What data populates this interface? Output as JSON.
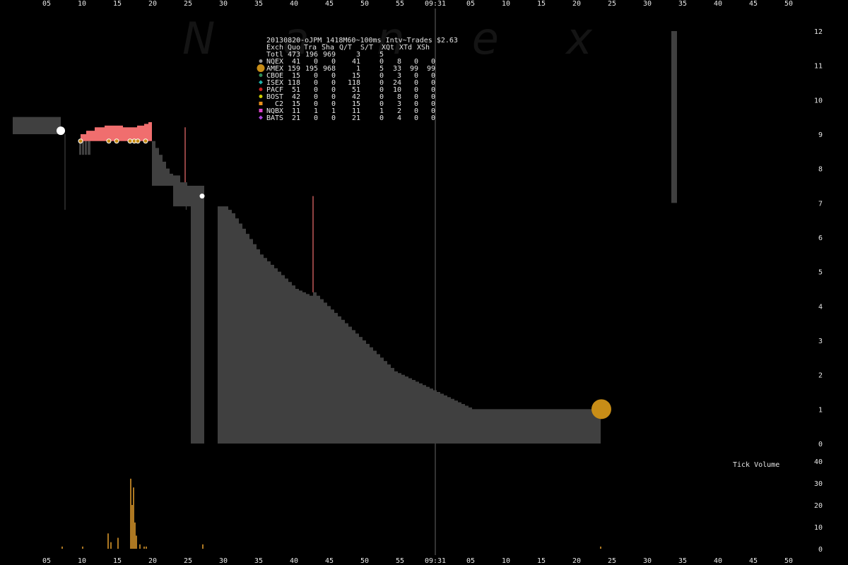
{
  "chart_data": {
    "type": "bar",
    "title": "20130820-oJPM_1418M60~100ms Intv~Trades $2.63",
    "watermark": "Nanex",
    "background": "#000000",
    "colors": {
      "price_band": "#404040",
      "bid_band": "#f06e6e",
      "grid": "#555555",
      "center_line": "#666666",
      "trade_amex": "#c88d17",
      "volume": "#d8962a",
      "nqex": "#999999",
      "cboe": "#2e8b57",
      "isex": "#20b2aa",
      "pacf": "#cc2222",
      "bost": "#cccc00",
      "c2": "#e8901b",
      "nqbx": "#dd44cc",
      "bats": "#aa44dd"
    },
    "x_ticks": [
      "05",
      "10",
      "15",
      "20",
      "25",
      "30",
      "35",
      "40",
      "45",
      "50",
      "55",
      "09:31",
      "05",
      "10",
      "15",
      "20",
      "25",
      "30",
      "35",
      "40",
      "45",
      "50"
    ],
    "x_axis": {
      "first_seconds": 5,
      "step_seconds": 5,
      "center_label": "09:31"
    },
    "price_axis": {
      "min": 0,
      "max": 12,
      "ticks": [
        "0",
        "1",
        "2",
        "3",
        "4",
        "5",
        "6",
        "7",
        "8",
        "9",
        "10",
        "11",
        "12"
      ]
    },
    "volume_axis": {
      "label": "Tick Volume",
      "min": 0,
      "max": 40,
      "ticks": [
        "0",
        "10",
        "20",
        "30",
        "40"
      ]
    },
    "legend": {
      "header": [
        "Exch",
        "Quo",
        "Tra",
        "Sha",
        "Q/T",
        "S/T",
        "XQt",
        "XTd",
        "XSh"
      ],
      "total": {
        "name": "Totl",
        "values": [
          "473",
          "196",
          "969",
          "3",
          "5",
          "",
          "",
          ""
        ]
      },
      "rows": [
        {
          "name": "NQEX",
          "marker": "circle",
          "color_key": "nqex",
          "values": [
            "41",
            "0",
            "0",
            "41",
            "0",
            "8",
            "0",
            "0"
          ]
        },
        {
          "name": "AMEX",
          "marker": "circle-large",
          "color_key": "trade_amex",
          "values": [
            "159",
            "195",
            "968",
            "1",
            "5",
            "33",
            "99",
            "99"
          ]
        },
        {
          "name": "CBOE",
          "marker": "circle",
          "color_key": "cboe",
          "values": [
            "15",
            "0",
            "0",
            "15",
            "0",
            "3",
            "0",
            "0"
          ]
        },
        {
          "name": "ISEX",
          "marker": "diamond",
          "color_key": "isex",
          "values": [
            "118",
            "0",
            "0",
            "118",
            "0",
            "24",
            "0",
            "0"
          ]
        },
        {
          "name": "PACF",
          "marker": "circle",
          "color_key": "pacf",
          "values": [
            "51",
            "0",
            "0",
            "51",
            "0",
            "10",
            "0",
            "0"
          ]
        },
        {
          "name": "BOST",
          "marker": "circle",
          "color_key": "bost",
          "values": [
            "42",
            "0",
            "0",
            "42",
            "0",
            "8",
            "0",
            "0"
          ]
        },
        {
          "name": "C2",
          "marker": "square",
          "color_key": "c2",
          "values": [
            "15",
            "0",
            "0",
            "15",
            "0",
            "3",
            "0",
            "0"
          ]
        },
        {
          "name": "NQBX",
          "marker": "square",
          "color_key": "nqbx",
          "values": [
            "11",
            "1",
            "1",
            "11",
            "1",
            "2",
            "0",
            "0"
          ]
        },
        {
          "name": "BATS",
          "marker": "diamond",
          "color_key": "bats",
          "values": [
            "21",
            "0",
            "0",
            "21",
            "0",
            "4",
            "0",
            "0"
          ]
        }
      ]
    },
    "price_bands": [
      {
        "t0": 0.2,
        "t1": 7.0,
        "lo": 9.0,
        "hi": 9.5
      },
      {
        "t0": 9.6,
        "t1": 9.9,
        "lo": 8.4,
        "hi": 8.8
      },
      {
        "t0": 10.0,
        "t1": 10.3,
        "lo": 8.4,
        "hi": 8.8
      },
      {
        "t0": 10.4,
        "t1": 10.7,
        "lo": 8.4,
        "hi": 8.8
      },
      {
        "t0": 10.8,
        "t1": 11.2,
        "lo": 8.4,
        "hi": 8.8
      },
      {
        "t0": 19.9,
        "t1": 20.4,
        "lo": 7.5,
        "hi": 8.8
      },
      {
        "t0": 20.4,
        "t1": 20.9,
        "lo": 7.5,
        "hi": 8.6
      },
      {
        "t0": 20.9,
        "t1": 21.4,
        "lo": 7.5,
        "hi": 8.4
      },
      {
        "t0": 21.4,
        "t1": 21.9,
        "lo": 7.5,
        "hi": 8.2
      },
      {
        "t0": 21.9,
        "t1": 22.4,
        "lo": 7.5,
        "hi": 8.0
      },
      {
        "t0": 22.4,
        "t1": 22.9,
        "lo": 7.5,
        "hi": 7.85
      },
      {
        "t0": 22.9,
        "t1": 23.9,
        "lo": 6.9,
        "hi": 7.8
      },
      {
        "t0": 23.9,
        "t1": 24.9,
        "lo": 6.9,
        "hi": 7.6
      },
      {
        "t0": 24.9,
        "t1": 25.4,
        "lo": 6.9,
        "hi": 7.5
      },
      {
        "t0": 25.4,
        "t1": 27.3,
        "lo": 0.0,
        "hi": 7.5
      },
      {
        "t0": 29.2,
        "t1": 30.2,
        "lo": 0.0,
        "hi": 6.9
      },
      {
        "t0": 30.2,
        "t1": 30.7,
        "lo": 0.0,
        "hi": 6.9
      },
      {
        "t0": 30.7,
        "t1": 31.2,
        "lo": 0.0,
        "hi": 6.8
      },
      {
        "t0": 31.2,
        "t1": 31.7,
        "lo": 0.0,
        "hi": 6.7
      },
      {
        "t0": 31.7,
        "t1": 32.2,
        "lo": 0.0,
        "hi": 6.55
      },
      {
        "t0": 32.2,
        "t1": 32.7,
        "lo": 0.0,
        "hi": 6.4
      },
      {
        "t0": 32.7,
        "t1": 33.2,
        "lo": 0.0,
        "hi": 6.25
      },
      {
        "t0": 33.2,
        "t1": 33.7,
        "lo": 0.0,
        "hi": 6.1
      },
      {
        "t0": 33.7,
        "t1": 34.2,
        "lo": 0.0,
        "hi": 5.95
      },
      {
        "t0": 34.2,
        "t1": 34.7,
        "lo": 0.0,
        "hi": 5.8
      },
      {
        "t0": 34.7,
        "t1": 35.2,
        "lo": 0.0,
        "hi": 5.65
      },
      {
        "t0": 35.2,
        "t1": 35.7,
        "lo": 0.0,
        "hi": 5.5
      },
      {
        "t0": 35.7,
        "t1": 36.2,
        "lo": 0.0,
        "hi": 5.4
      },
      {
        "t0": 36.2,
        "t1": 36.7,
        "lo": 0.0,
        "hi": 5.3
      },
      {
        "t0": 36.7,
        "t1": 37.2,
        "lo": 0.0,
        "hi": 5.2
      },
      {
        "t0": 37.2,
        "t1": 37.7,
        "lo": 0.0,
        "hi": 5.1
      },
      {
        "t0": 37.7,
        "t1": 38.2,
        "lo": 0.0,
        "hi": 5.0
      },
      {
        "t0": 38.2,
        "t1": 38.7,
        "lo": 0.0,
        "hi": 4.9
      },
      {
        "t0": 38.7,
        "t1": 39.2,
        "lo": 0.0,
        "hi": 4.8
      },
      {
        "t0": 39.2,
        "t1": 39.7,
        "lo": 0.0,
        "hi": 4.7
      },
      {
        "t0": 39.7,
        "t1": 40.2,
        "lo": 0.0,
        "hi": 4.6
      },
      {
        "t0": 40.2,
        "t1": 40.7,
        "lo": 0.0,
        "hi": 4.5
      },
      {
        "t0": 40.7,
        "t1": 41.2,
        "lo": 0.0,
        "hi": 4.45
      },
      {
        "t0": 41.2,
        "t1": 41.7,
        "lo": 0.0,
        "hi": 4.4
      },
      {
        "t0": 41.7,
        "t1": 42.2,
        "lo": 0.0,
        "hi": 4.35
      },
      {
        "t0": 42.2,
        "t1": 42.7,
        "lo": 0.0,
        "hi": 4.3
      },
      {
        "t0": 42.7,
        "t1": 43.2,
        "lo": 0.0,
        "hi": 4.4
      },
      {
        "t0": 43.2,
        "t1": 43.7,
        "lo": 0.0,
        "hi": 4.3
      },
      {
        "t0": 43.7,
        "t1": 44.2,
        "lo": 0.0,
        "hi": 4.2
      },
      {
        "t0": 44.2,
        "t1": 44.7,
        "lo": 0.0,
        "hi": 4.1
      },
      {
        "t0": 44.7,
        "t1": 45.2,
        "lo": 0.0,
        "hi": 4.0
      },
      {
        "t0": 45.2,
        "t1": 45.7,
        "lo": 0.0,
        "hi": 3.9
      },
      {
        "t0": 45.7,
        "t1": 46.2,
        "lo": 0.0,
        "hi": 3.8
      },
      {
        "t0": 46.2,
        "t1": 46.7,
        "lo": 0.0,
        "hi": 3.7
      },
      {
        "t0": 46.7,
        "t1": 47.2,
        "lo": 0.0,
        "hi": 3.6
      },
      {
        "t0": 47.2,
        "t1": 47.7,
        "lo": 0.0,
        "hi": 3.5
      },
      {
        "t0": 47.7,
        "t1": 48.2,
        "lo": 0.0,
        "hi": 3.4
      },
      {
        "t0": 48.2,
        "t1": 48.7,
        "lo": 0.0,
        "hi": 3.3
      },
      {
        "t0": 48.7,
        "t1": 49.2,
        "lo": 0.0,
        "hi": 3.2
      },
      {
        "t0": 49.2,
        "t1": 49.7,
        "lo": 0.0,
        "hi": 3.1
      },
      {
        "t0": 49.7,
        "t1": 50.2,
        "lo": 0.0,
        "hi": 3.0
      },
      {
        "t0": 50.2,
        "t1": 50.7,
        "lo": 0.0,
        "hi": 2.9
      },
      {
        "t0": 50.7,
        "t1": 51.2,
        "lo": 0.0,
        "hi": 2.8
      },
      {
        "t0": 51.2,
        "t1": 51.7,
        "lo": 0.0,
        "hi": 2.7
      },
      {
        "t0": 51.7,
        "t1": 52.2,
        "lo": 0.0,
        "hi": 2.6
      },
      {
        "t0": 52.2,
        "t1": 52.7,
        "lo": 0.0,
        "hi": 2.5
      },
      {
        "t0": 52.7,
        "t1": 53.2,
        "lo": 0.0,
        "hi": 2.4
      },
      {
        "t0": 53.2,
        "t1": 53.7,
        "lo": 0.0,
        "hi": 2.3
      },
      {
        "t0": 53.7,
        "t1": 54.2,
        "lo": 0.0,
        "hi": 2.2
      },
      {
        "t0": 54.2,
        "t1": 54.7,
        "lo": 0.0,
        "hi": 2.1
      },
      {
        "t0": 54.7,
        "t1": 55.2,
        "lo": 0.0,
        "hi": 2.05
      },
      {
        "t0": 55.2,
        "t1": 55.7,
        "lo": 0.0,
        "hi": 2.0
      },
      {
        "t0": 55.7,
        "t1": 56.2,
        "lo": 0.0,
        "hi": 1.95
      },
      {
        "t0": 56.2,
        "t1": 56.7,
        "lo": 0.0,
        "hi": 1.9
      },
      {
        "t0": 56.7,
        "t1": 57.2,
        "lo": 0.0,
        "hi": 1.85
      },
      {
        "t0": 57.2,
        "t1": 57.7,
        "lo": 0.0,
        "hi": 1.8
      },
      {
        "t0": 57.7,
        "t1": 58.2,
        "lo": 0.0,
        "hi": 1.75
      },
      {
        "t0": 58.2,
        "t1": 58.7,
        "lo": 0.0,
        "hi": 1.7
      },
      {
        "t0": 58.7,
        "t1": 59.2,
        "lo": 0.0,
        "hi": 1.65
      },
      {
        "t0": 59.2,
        "t1": 59.7,
        "lo": 0.0,
        "hi": 1.6
      },
      {
        "t0": 59.7,
        "t1": 60.2,
        "lo": 0.0,
        "hi": 1.55
      },
      {
        "t0": 60.2,
        "t1": 60.7,
        "lo": 0.0,
        "hi": 1.5
      },
      {
        "t0": 60.7,
        "t1": 61.2,
        "lo": 0.0,
        "hi": 1.45
      },
      {
        "t0": 61.2,
        "t1": 61.7,
        "lo": 0.0,
        "hi": 1.4
      },
      {
        "t0": 61.7,
        "t1": 62.2,
        "lo": 0.0,
        "hi": 1.35
      },
      {
        "t0": 62.2,
        "t1": 62.7,
        "lo": 0.0,
        "hi": 1.3
      },
      {
        "t0": 62.7,
        "t1": 63.2,
        "lo": 0.0,
        "hi": 1.25
      },
      {
        "t0": 63.2,
        "t1": 63.7,
        "lo": 0.0,
        "hi": 1.2
      },
      {
        "t0": 63.7,
        "t1": 64.2,
        "lo": 0.0,
        "hi": 1.15
      },
      {
        "t0": 64.2,
        "t1": 64.7,
        "lo": 0.0,
        "hi": 1.1
      },
      {
        "t0": 64.7,
        "t1": 65.2,
        "lo": 0.0,
        "hi": 1.05
      },
      {
        "t0": 65.2,
        "t1": 83.4,
        "lo": 0.0,
        "hi": 1.0
      },
      {
        "t0": 93.4,
        "t1": 94.2,
        "lo": 7.0,
        "hi": 12.0
      }
    ],
    "bid_steps": [
      {
        "t0": 9.8,
        "t1": 10.6,
        "lo": 8.8,
        "hi": 9.0
      },
      {
        "t0": 10.6,
        "t1": 11.8,
        "lo": 8.8,
        "hi": 9.1
      },
      {
        "t0": 11.8,
        "t1": 13.2,
        "lo": 8.8,
        "hi": 9.2
      },
      {
        "t0": 13.2,
        "t1": 15.8,
        "lo": 8.8,
        "hi": 9.25
      },
      {
        "t0": 15.8,
        "t1": 17.8,
        "lo": 8.8,
        "hi": 9.2
      },
      {
        "t0": 17.8,
        "t1": 18.8,
        "lo": 8.8,
        "hi": 9.25
      },
      {
        "t0": 18.8,
        "t1": 19.4,
        "lo": 8.8,
        "hi": 9.3
      },
      {
        "t0": 19.4,
        "t1": 19.9,
        "lo": 8.8,
        "hi": 9.35
      }
    ],
    "spikes": [
      {
        "t": 7.6,
        "lo": 6.8,
        "hi": 9.0,
        "color_key": "price_band"
      },
      {
        "t": 24.6,
        "lo": 7.6,
        "hi": 9.2,
        "color_key": "bid_band"
      },
      {
        "t": 24.75,
        "lo": 6.8,
        "hi": 7.6,
        "color_key": "price_band"
      },
      {
        "t": 38.9,
        "lo": 0.0,
        "hi": 4.6,
        "color_key": "price_band"
      },
      {
        "t": 39.3,
        "lo": 0.0,
        "hi": 4.7,
        "color_key": "price_band"
      },
      {
        "t": 42.7,
        "lo": 4.4,
        "hi": 7.2,
        "color_key": "bid_band"
      },
      {
        "t": 42.8,
        "lo": 0.0,
        "hi": 4.4,
        "color_key": "price_band"
      }
    ],
    "trades": [
      {
        "t": 7.0,
        "price": 9.1,
        "size": "large",
        "color_key": "white"
      },
      {
        "t": 9.8,
        "price": 8.8,
        "size": "small",
        "color_key": "trade_amex"
      },
      {
        "t": 13.8,
        "price": 8.8,
        "size": "small",
        "color_key": "trade_amex"
      },
      {
        "t": 14.9,
        "price": 8.8,
        "size": "small",
        "color_key": "trade_amex"
      },
      {
        "t": 16.8,
        "price": 8.8,
        "size": "small",
        "color_key": "trade_amex"
      },
      {
        "t": 17.4,
        "price": 8.8,
        "size": "small",
        "color_key": "trade_amex"
      },
      {
        "t": 17.9,
        "price": 8.8,
        "size": "small",
        "color_key": "trade_amex"
      },
      {
        "t": 19.0,
        "price": 8.8,
        "size": "small",
        "color_key": "trade_amex"
      },
      {
        "t": 27.0,
        "price": 7.2,
        "size": "small",
        "color_key": "white"
      },
      {
        "t": 83.5,
        "price": 1.0,
        "size": "xlarge",
        "color_key": "trade_amex"
      }
    ],
    "volume": [
      {
        "t": 7.2,
        "v": 1
      },
      {
        "t": 10.1,
        "v": 1
      },
      {
        "t": 13.7,
        "v": 7
      },
      {
        "t": 14.1,
        "v": 3
      },
      {
        "t": 15.1,
        "v": 5
      },
      {
        "t": 16.9,
        "v": 32
      },
      {
        "t": 17.1,
        "v": 20
      },
      {
        "t": 17.3,
        "v": 28
      },
      {
        "t": 17.5,
        "v": 12
      },
      {
        "t": 17.7,
        "v": 6
      },
      {
        "t": 18.2,
        "v": 2
      },
      {
        "t": 18.8,
        "v": 1
      },
      {
        "t": 19.1,
        "v": 1
      },
      {
        "t": 27.1,
        "v": 2
      },
      {
        "t": 83.4,
        "v": 1
      }
    ]
  }
}
